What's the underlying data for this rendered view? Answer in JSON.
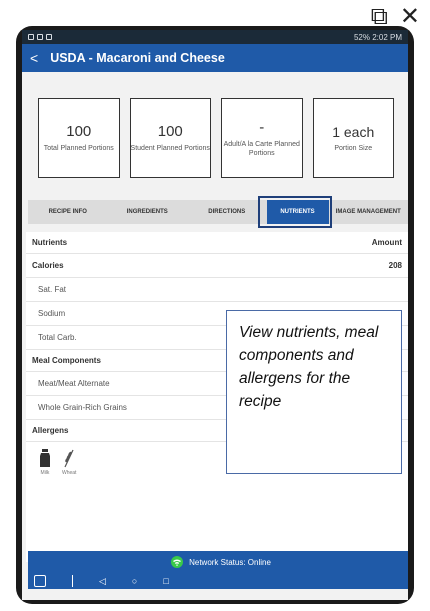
{
  "overlay": {
    "open_icon": "external-open-icon",
    "close_icon": "close-icon"
  },
  "status_bar": {
    "right": "52% 2:02 PM"
  },
  "header": {
    "back": "<",
    "title": "USDA - Macaroni and Cheese"
  },
  "cards": [
    {
      "value": "100",
      "label": "Total Planned Portions"
    },
    {
      "value": "100",
      "label": "Student Planned Portions"
    },
    {
      "value": "-",
      "label": "Adult/A la Carte Planned Portions"
    },
    {
      "value": "1 each",
      "label": "Portion Size"
    }
  ],
  "tabs": [
    "RECIPE INFO",
    "INGREDIENTS",
    "DIRECTIONS",
    "NUTRIENTS",
    "IMAGE MANAGEMENT"
  ],
  "nutrients": {
    "header": {
      "name": "Nutrients",
      "amount": "Amount"
    },
    "calories": {
      "name": "Calories",
      "amount": "208"
    },
    "rows": [
      "Sat. Fat",
      "Sodium",
      "Total Carb."
    ]
  },
  "meal_components": {
    "title": "Meal Components",
    "rows": [
      "Meat/Meat Alternate",
      "Whole Grain-Rich Grains"
    ]
  },
  "allergens": {
    "title": "Allergens",
    "items": [
      "Milk",
      "Wheat"
    ]
  },
  "callout": {
    "text": "View nutrients, meal components and allergens for the recipe"
  },
  "network": {
    "text": "Network Status: Online"
  }
}
